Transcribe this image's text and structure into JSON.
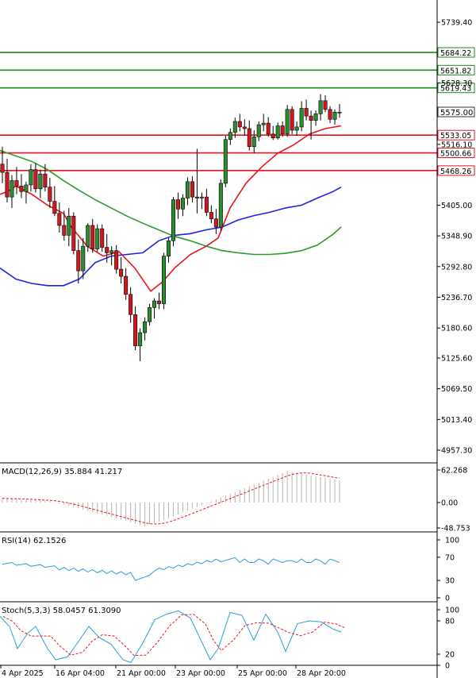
{
  "chart_data": {
    "type": "candlestick",
    "price_axis": {
      "ticks": [
        "5739.40",
        "5628.30",
        "5516.10",
        "5405.00",
        "5348.90",
        "5292.80",
        "5236.70",
        "5180.60",
        "5125.60",
        "5069.50",
        "5013.40",
        "4957.30"
      ],
      "range": [
        4930,
        5790
      ]
    },
    "current_price": "5575.00",
    "levels": [
      {
        "label": "5684.22",
        "value": 5684.22,
        "color": "#1e8a1e"
      },
      {
        "label": "5651.82",
        "value": 5651.82,
        "color": "#1e8a1e"
      },
      {
        "label": "5619.43",
        "value": 5619.43,
        "color": "#1e8a1e"
      },
      {
        "label": "5533.05",
        "value": 5533.05,
        "color": "#e8141e"
      },
      {
        "label": "5500.66",
        "value": 5500.66,
        "color": "#e8141e"
      },
      {
        "label": "5468.26",
        "value": 5468.26,
        "color": "#e8141e"
      }
    ],
    "x_labels": [
      "4 Apr 2025",
      "16 Apr 04:00",
      "21 Apr 00:00",
      "23 Apr 00:00",
      "25 Apr 00:00",
      "28 Apr 20:00"
    ],
    "candles": [
      [
        5480,
        5512,
        5445,
        5465
      ],
      [
        5465,
        5490,
        5410,
        5420
      ],
      [
        5420,
        5460,
        5400,
        5450
      ],
      [
        5450,
        5475,
        5425,
        5440
      ],
      [
        5440,
        5462,
        5418,
        5430
      ],
      [
        5430,
        5448,
        5408,
        5442
      ],
      [
        5442,
        5480,
        5430,
        5470
      ],
      [
        5470,
        5482,
        5428,
        5435
      ],
      [
        5435,
        5470,
        5418,
        5462
      ],
      [
        5462,
        5480,
        5430,
        5438
      ],
      [
        5438,
        5455,
        5400,
        5412
      ],
      [
        5412,
        5440,
        5385,
        5390
      ],
      [
        5390,
        5410,
        5355,
        5368
      ],
      [
        5368,
        5395,
        5340,
        5350
      ],
      [
        5350,
        5400,
        5330,
        5385
      ],
      [
        5385,
        5392,
        5315,
        5322
      ],
      [
        5322,
        5342,
        5262,
        5285
      ],
      [
        5285,
        5345,
        5270,
        5330
      ],
      [
        5330,
        5372,
        5320,
        5368
      ],
      [
        5368,
        5380,
        5318,
        5325
      ],
      [
        5325,
        5370,
        5320,
        5362
      ],
      [
        5362,
        5370,
        5320,
        5328
      ],
      [
        5328,
        5352,
        5300,
        5318
      ],
      [
        5318,
        5330,
        5295,
        5322
      ],
      [
        5322,
        5332,
        5280,
        5288
      ],
      [
        5288,
        5310,
        5262,
        5275
      ],
      [
        5275,
        5290,
        5232,
        5242
      ],
      [
        5242,
        5255,
        5190,
        5205
      ],
      [
        5205,
        5220,
        5140,
        5148
      ],
      [
        5148,
        5180,
        5120,
        5172
      ],
      [
        5172,
        5200,
        5158,
        5192
      ],
      [
        5192,
        5225,
        5185,
        5218
      ],
      [
        5218,
        5235,
        5198,
        5230
      ],
      [
        5230,
        5245,
        5215,
        5225
      ],
      [
        5225,
        5318,
        5215,
        5312
      ],
      [
        5312,
        5345,
        5300,
        5340
      ],
      [
        5340,
        5420,
        5330,
        5415
      ],
      [
        5415,
        5428,
        5380,
        5398
      ],
      [
        5398,
        5425,
        5385,
        5418
      ],
      [
        5418,
        5456,
        5405,
        5448
      ],
      [
        5448,
        5458,
        5410,
        5420
      ],
      [
        5420,
        5508,
        5390,
        5418
      ],
      [
        5418,
        5428,
        5398,
        5420
      ],
      [
        5420,
        5435,
        5385,
        5392
      ],
      [
        5392,
        5405,
        5372,
        5380
      ],
      [
        5380,
        5398,
        5352,
        5365
      ],
      [
        5365,
        5452,
        5358,
        5445
      ],
      [
        5445,
        5532,
        5438,
        5525
      ],
      [
        5525,
        5545,
        5515,
        5538
      ],
      [
        5538,
        5565,
        5528,
        5558
      ],
      [
        5558,
        5572,
        5540,
        5548
      ],
      [
        5548,
        5562,
        5532,
        5545
      ],
      [
        5545,
        5560,
        5505,
        5512
      ],
      [
        5512,
        5542,
        5500,
        5530
      ],
      [
        5530,
        5558,
        5522,
        5552
      ],
      [
        5552,
        5572,
        5540,
        5555
      ],
      [
        5555,
        5566,
        5530,
        5535
      ],
      [
        5535,
        5550,
        5524,
        5528
      ],
      [
        5528,
        5556,
        5525,
        5550
      ],
      [
        5550,
        5558,
        5530,
        5535
      ],
      [
        5535,
        5588,
        5530,
        5580
      ],
      [
        5580,
        5586,
        5535,
        5542
      ],
      [
        5542,
        5558,
        5532,
        5548
      ],
      [
        5548,
        5595,
        5540,
        5582
      ],
      [
        5582,
        5598,
        5560,
        5568
      ],
      [
        5568,
        5578,
        5525,
        5560
      ],
      [
        5560,
        5578,
        5550,
        5572
      ],
      [
        5572,
        5608,
        5560,
        5596
      ],
      [
        5596,
        5606,
        5575,
        5580
      ],
      [
        5580,
        5586,
        5555,
        5562
      ],
      [
        5562,
        5580,
        5552,
        5575
      ],
      [
        5575,
        5590,
        5565,
        5575
      ]
    ],
    "ma_red": [
      [
        0,
        5425
      ],
      [
        10,
        5430
      ],
      [
        20,
        5440
      ],
      [
        40,
        5425
      ],
      [
        60,
        5405
      ],
      [
        80,
        5390
      ],
      [
        90,
        5365
      ],
      [
        110,
        5330
      ],
      [
        130,
        5312
      ],
      [
        150,
        5320
      ],
      [
        170,
        5290
      ],
      [
        190,
        5248
      ],
      [
        205,
        5265
      ],
      [
        220,
        5290
      ],
      [
        240,
        5315
      ],
      [
        260,
        5330
      ],
      [
        275,
        5345
      ],
      [
        290,
        5400
      ],
      [
        310,
        5445
      ],
      [
        330,
        5475
      ],
      [
        350,
        5500
      ],
      [
        370,
        5515
      ],
      [
        390,
        5535
      ],
      [
        410,
        5545
      ],
      [
        430,
        5550
      ]
    ],
    "ma_blue": [
      [
        0,
        5290
      ],
      [
        20,
        5270
      ],
      [
        40,
        5262
      ],
      [
        60,
        5258
      ],
      [
        80,
        5258
      ],
      [
        100,
        5270
      ],
      [
        120,
        5300
      ],
      [
        140,
        5312
      ],
      [
        160,
        5315
      ],
      [
        180,
        5318
      ],
      [
        200,
        5340
      ],
      [
        220,
        5350
      ],
      [
        240,
        5353
      ],
      [
        260,
        5360
      ],
      [
        280,
        5365
      ],
      [
        300,
        5378
      ],
      [
        320,
        5386
      ],
      [
        340,
        5392
      ],
      [
        360,
        5400
      ],
      [
        380,
        5405
      ],
      [
        400,
        5418
      ],
      [
        420,
        5430
      ],
      [
        430,
        5438
      ]
    ],
    "ma_green": [
      [
        0,
        5505
      ],
      [
        20,
        5495
      ],
      [
        40,
        5485
      ],
      [
        60,
        5470
      ],
      [
        80,
        5450
      ],
      [
        100,
        5432
      ],
      [
        120,
        5415
      ],
      [
        140,
        5400
      ],
      [
        160,
        5385
      ],
      [
        180,
        5372
      ],
      [
        200,
        5360
      ],
      [
        220,
        5348
      ],
      [
        240,
        5340
      ],
      [
        260,
        5330
      ],
      [
        280,
        5322
      ],
      [
        300,
        5318
      ],
      [
        320,
        5315
      ],
      [
        340,
        5315
      ],
      [
        360,
        5317
      ],
      [
        380,
        5322
      ],
      [
        400,
        5332
      ],
      [
        420,
        5352
      ],
      [
        430,
        5365
      ]
    ],
    "macd": {
      "label": "MACD(12,26,9) 35.884 41.217",
      "ticks": [
        "62.268",
        "0.00",
        "-48.753"
      ],
      "range": [
        -55,
        70
      ]
    },
    "rsi": {
      "label": "RSI(14) 62.1526",
      "ticks": [
        "100",
        "70",
        "30",
        "0"
      ],
      "range": [
        0,
        100
      ]
    },
    "stoch": {
      "label": "Stoch(5,3,3) 58.0457 61.3090",
      "ticks": [
        "100",
        "80",
        "20",
        "0"
      ],
      "range": [
        0,
        100
      ]
    }
  }
}
